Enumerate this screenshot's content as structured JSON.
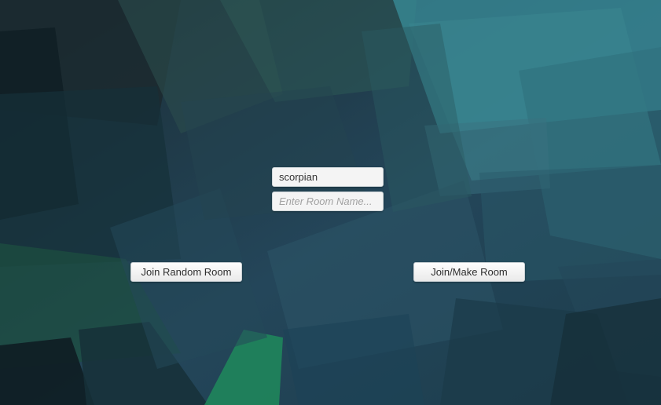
{
  "login": {
    "name_value": "scorpian",
    "room_placeholder": "Enter Room Name...",
    "room_value": ""
  },
  "buttons": {
    "join_random_label": "Join Random Room",
    "join_make_label": "Join/Make Room"
  },
  "colors": {
    "bg_dark": "#12262f",
    "bg_teal": "#3a8a94",
    "bg_green": "#1f8a5c",
    "field_bg": "#f4f4f4",
    "button_bg": "#f7f7f7"
  }
}
